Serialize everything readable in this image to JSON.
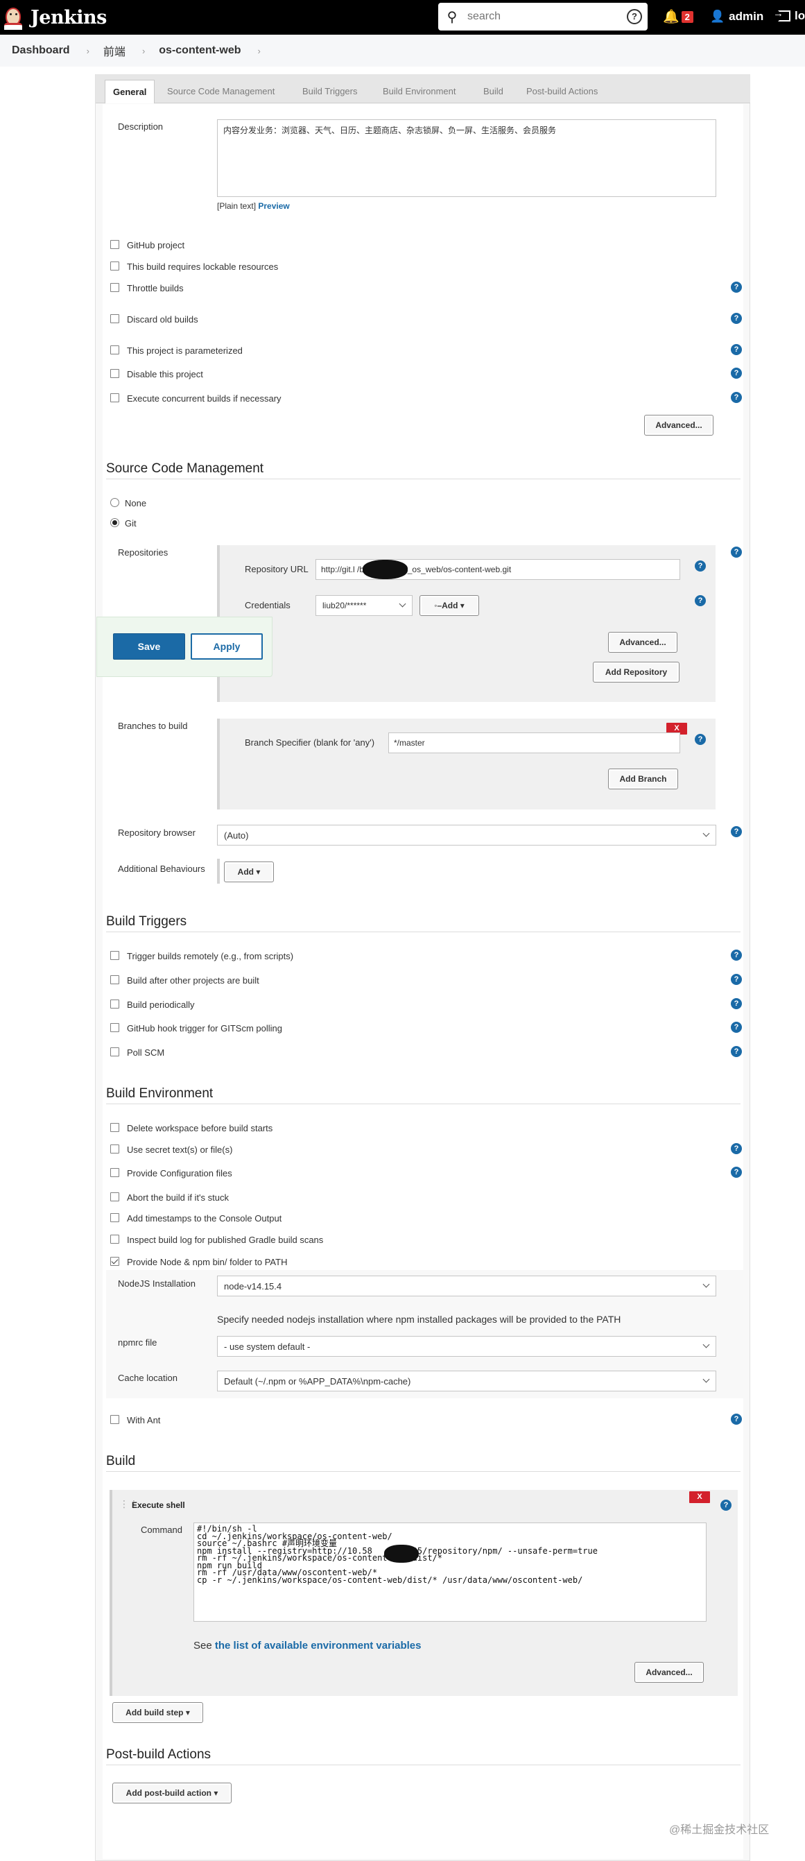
{
  "header": {
    "app_name": "Jenkins",
    "search_placeholder": "search",
    "notification_count": "2",
    "user": "admin",
    "logout_label": "lo"
  },
  "breadcrumb": [
    "Dashboard",
    "前端",
    "os-content-web"
  ],
  "tabs": [
    "General",
    "Source Code Management",
    "Build Triggers",
    "Build Environment",
    "Build",
    "Post-build Actions"
  ],
  "general": {
    "description_label": "Description",
    "description_value": "内容分发业务：浏览器、天气、日历、主题商店、杂志锁屏、负一屏、生活服务、会员服务",
    "plain_text": "[Plain text]",
    "preview": "Preview",
    "options": [
      {
        "label": "GitHub project",
        "checked": false
      },
      {
        "label": "This build requires lockable resources",
        "checked": false
      },
      {
        "label": "Throttle builds",
        "checked": false
      },
      {
        "label": "Discard old builds",
        "checked": false
      },
      {
        "label": "This project is parameterized",
        "checked": false
      },
      {
        "label": "Disable this project",
        "checked": false
      },
      {
        "label": "Execute concurrent builds if necessary",
        "checked": false
      }
    ],
    "advanced": "Advanced..."
  },
  "scm": {
    "title": "Source Code Management",
    "none": "None",
    "git": "Git",
    "repositories_label": "Repositories",
    "repo_url_label": "Repository URL",
    "repo_url": "http://git.l          /bn-mobile/bn_os_web/os-content-web.git",
    "credentials_label": "Credentials",
    "credentials_value": "liub20/******",
    "add": "Add",
    "advanced": "Advanced...",
    "add_repository": "Add Repository",
    "branches_label": "Branches to build",
    "branch_specifier_label": "Branch Specifier (blank for 'any')",
    "branch_specifier": "*/master",
    "x": "X",
    "add_branch": "Add Branch",
    "repo_browser_label": "Repository browser",
    "repo_browser": "(Auto)",
    "additional_label": "Additional Behaviours",
    "additional_add": "Add"
  },
  "triggers": {
    "title": "Build Triggers",
    "options": [
      {
        "label": "Trigger builds remotely (e.g., from scripts)",
        "checked": false
      },
      {
        "label": "Build after other projects are built",
        "checked": false
      },
      {
        "label": "Build periodically",
        "checked": false
      },
      {
        "label": "GitHub hook trigger for GITScm polling",
        "checked": false
      },
      {
        "label": "Poll SCM",
        "checked": false
      }
    ]
  },
  "environment": {
    "title": "Build Environment",
    "options": [
      {
        "label": "Delete workspace before build starts",
        "checked": false
      },
      {
        "label": "Use secret text(s) or file(s)",
        "checked": false
      },
      {
        "label": "Provide Configuration files",
        "checked": false
      },
      {
        "label": "Abort the build if it's stuck",
        "checked": false
      },
      {
        "label": "Add timestamps to the Console Output",
        "checked": false
      },
      {
        "label": "Inspect build log for published Gradle build scans",
        "checked": false
      },
      {
        "label": "Provide Node & npm bin/ folder to PATH",
        "checked": true
      }
    ],
    "nodejs_label": "NodeJS Installation",
    "nodejs_value": "node-v14.15.4",
    "nodejs_hint": "Specify needed nodejs installation where npm installed packages will be provided to the PATH",
    "npmrc_label": "npmrc file",
    "npmrc_value": "- use system default -",
    "cache_label": "Cache location",
    "cache_value": "Default (~/.npm or %APP_DATA%\\npm-cache)",
    "with_ant": "With Ant"
  },
  "build": {
    "title": "Build",
    "step_title": "Execute shell",
    "x": "X",
    "command_label": "Command",
    "command_lines": [
      "#!/bin/sh -l",
      "cd ~/.jenkins/workspace/os-content-web/",
      "source ~/.bashrc #声明环境变量",
      "npm install --registry=http://10.58        95/repository/npm/ --unsafe-perm=true",
      "rm -rf ~/.jenkins/workspace/os-content-web/dist/*",
      "npm run build",
      "rm -rf /usr/data/www/oscontent-web/*",
      "cp -r ~/.jenkins/workspace/os-content-web/dist/* /usr/data/www/oscontent-web/"
    ],
    "see_prefix": "See",
    "see_link": "the list of available environment variables",
    "advanced": "Advanced...",
    "add_build_step": "Add build step"
  },
  "post_build": {
    "title": "Post-build Actions",
    "add_action": "Add post-build action"
  },
  "footer": {
    "save": "Save",
    "apply": "Apply"
  },
  "watermark": "@稀土掘金技术社区"
}
